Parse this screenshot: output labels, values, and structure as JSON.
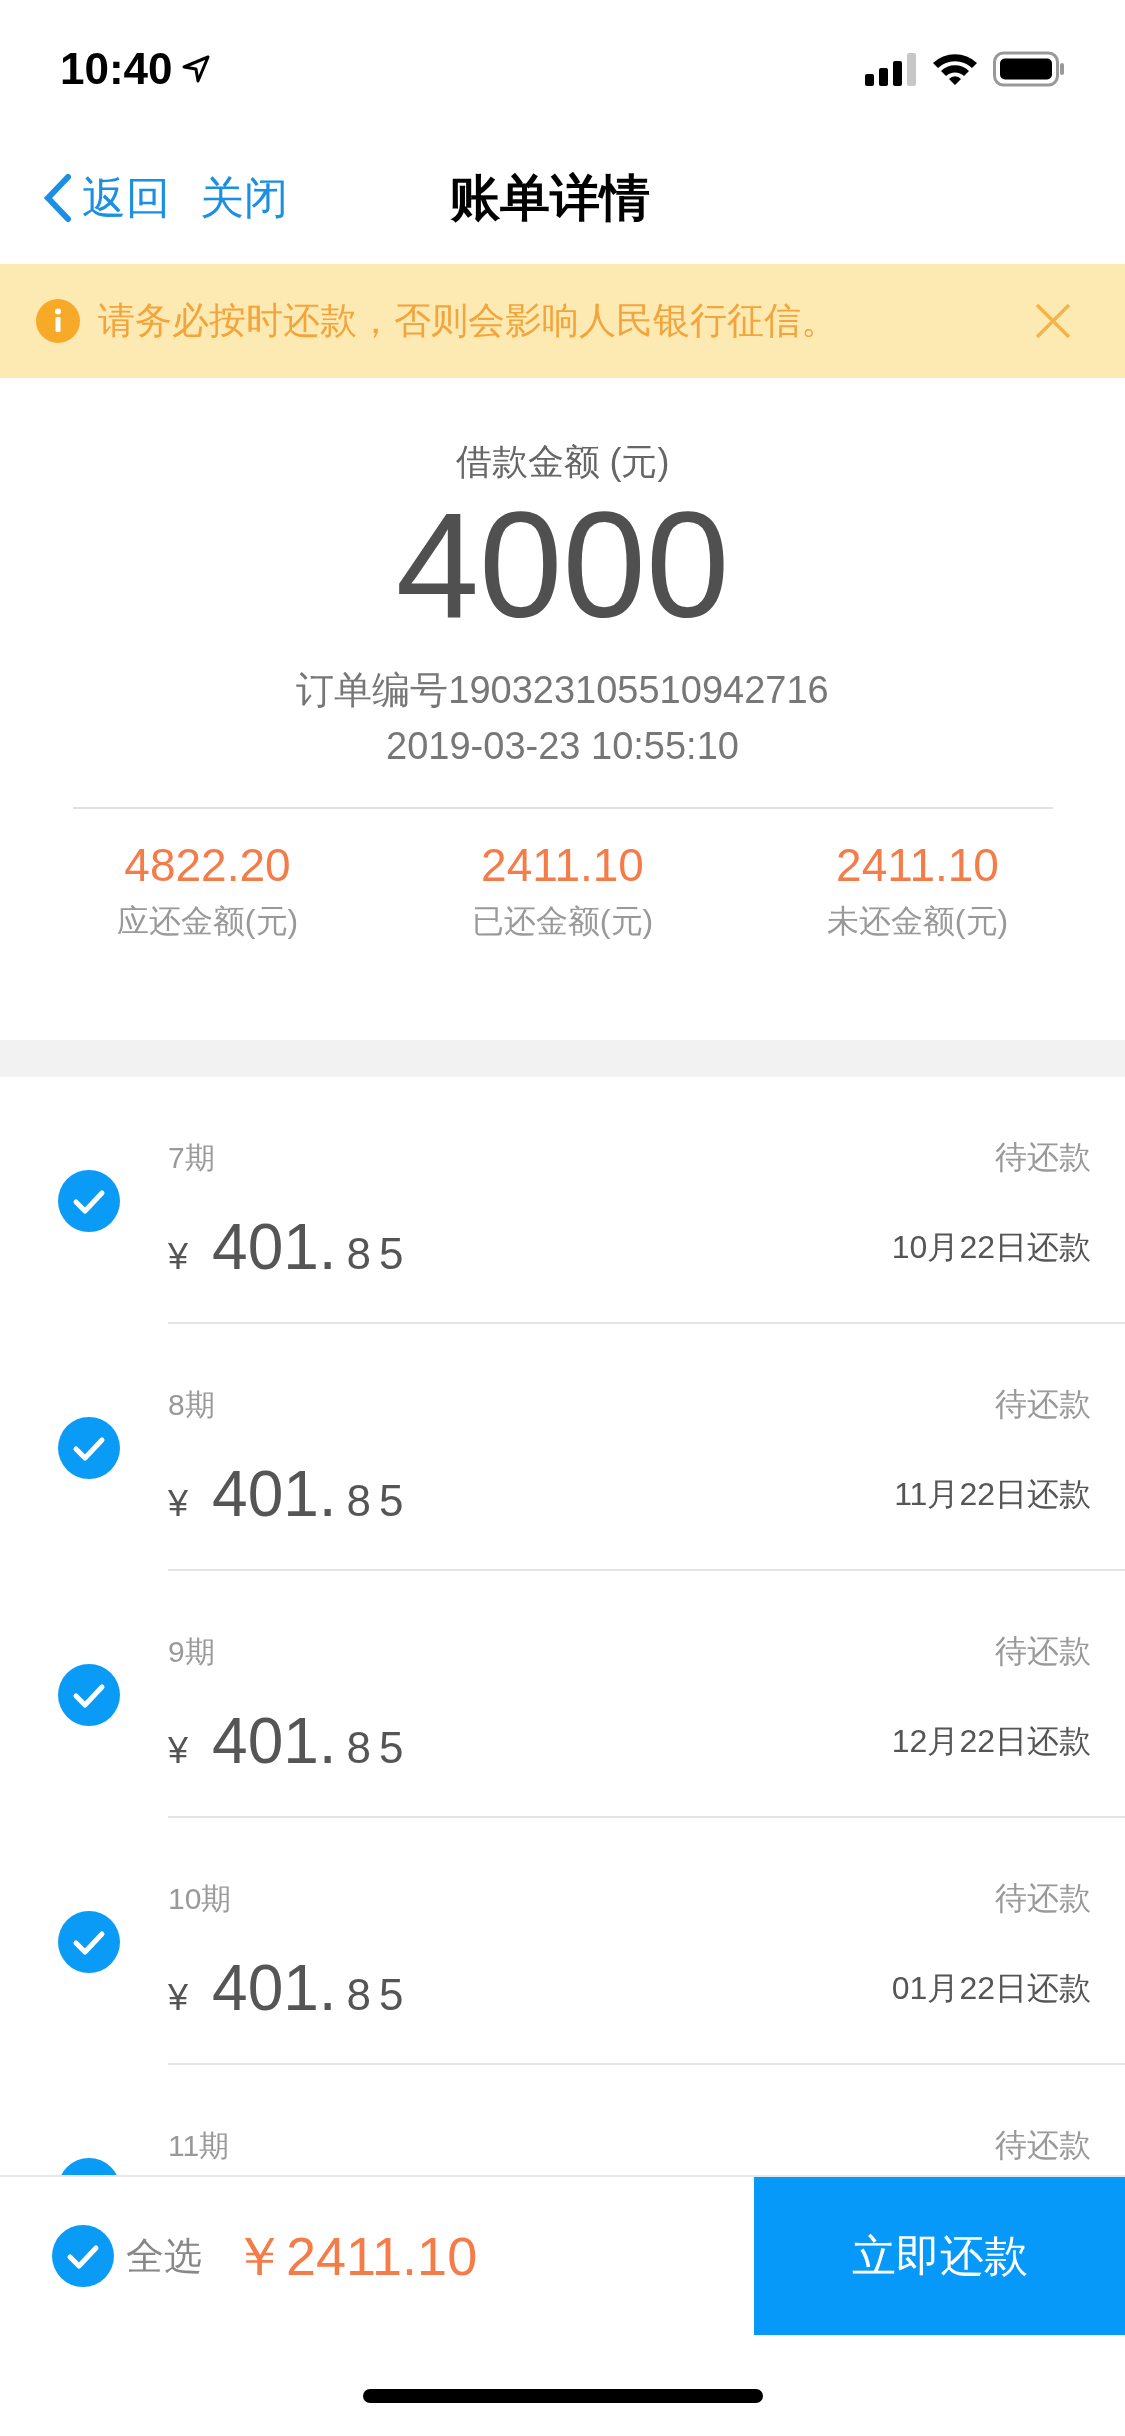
{
  "status_bar": {
    "time": "10:40"
  },
  "nav": {
    "back": "返回",
    "close": "关闭",
    "title": "账单详情"
  },
  "notice": {
    "text": "请务必按时还款，否则会影响人民银行征信。"
  },
  "loan": {
    "label": "借款金额 (元)",
    "amount": "4000",
    "order": "订单编号190323105510942716",
    "datetime": "2019-03-23 10:55:10"
  },
  "stats": [
    {
      "value": "4822.20",
      "label": "应还金额(元)"
    },
    {
      "value": "2411.10",
      "label": "已还金额(元)"
    },
    {
      "value": "2411.10",
      "label": "未还金额(元)"
    }
  ],
  "installments": [
    {
      "period": "7期",
      "status": "待还款",
      "currency": "¥",
      "amount_main": "401.",
      "amount_fraction": "85",
      "due": "10月22日还款",
      "checked": true
    },
    {
      "period": "8期",
      "status": "待还款",
      "currency": "¥",
      "amount_main": "401.",
      "amount_fraction": "85",
      "due": "11月22日还款",
      "checked": true
    },
    {
      "period": "9期",
      "status": "待还款",
      "currency": "¥",
      "amount_main": "401.",
      "amount_fraction": "85",
      "due": "12月22日还款",
      "checked": true
    },
    {
      "period": "10期",
      "status": "待还款",
      "currency": "¥",
      "amount_main": "401.",
      "amount_fraction": "85",
      "due": "01月22日还款",
      "checked": true
    },
    {
      "period": "11期",
      "status": "待还款",
      "checked": true
    }
  ],
  "footer": {
    "select_all_label": "全选",
    "select_all_checked": true,
    "total": "￥2411.10",
    "pay_button": "立即还款"
  }
}
